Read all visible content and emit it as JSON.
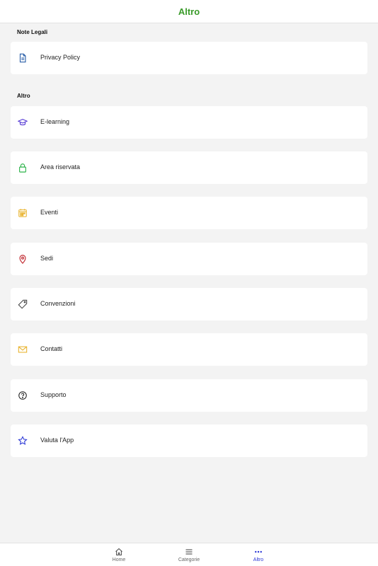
{
  "header": {
    "title": "Altro"
  },
  "sections": {
    "legal": {
      "label": "Note Legali"
    },
    "other": {
      "label": "Altro"
    }
  },
  "items": [
    {
      "label": "Privacy Policy",
      "icon": "document-icon",
      "color": "#2a5fa8"
    },
    {
      "label": "E-learning",
      "icon": "graduation-cap-icon",
      "color": "#5a3fd6"
    },
    {
      "label": "Area riservata",
      "icon": "lock-icon",
      "color": "#2db34a"
    },
    {
      "label": "Eventi",
      "icon": "calendar-icon",
      "color": "#e8b22a"
    },
    {
      "label": "Sedi",
      "icon": "location-pin-icon",
      "color": "#c0262d"
    },
    {
      "label": "Convenzioni",
      "icon": "tag-icon",
      "color": "#444444"
    },
    {
      "label": "Contatti",
      "icon": "mail-icon",
      "color": "#e8b22a"
    },
    {
      "label": "Supporto",
      "icon": "help-icon",
      "color": "#222222"
    },
    {
      "label": "Valuta l'App",
      "icon": "star-icon",
      "color": "#2c38d6"
    }
  ],
  "tabbar": {
    "tabs": [
      {
        "label": "Home",
        "icon": "home-icon"
      },
      {
        "label": "Categorie",
        "icon": "menu-icon"
      },
      {
        "label": "Altro",
        "icon": "more-icon",
        "active": true
      }
    ],
    "active_color": "#2c38d6"
  }
}
